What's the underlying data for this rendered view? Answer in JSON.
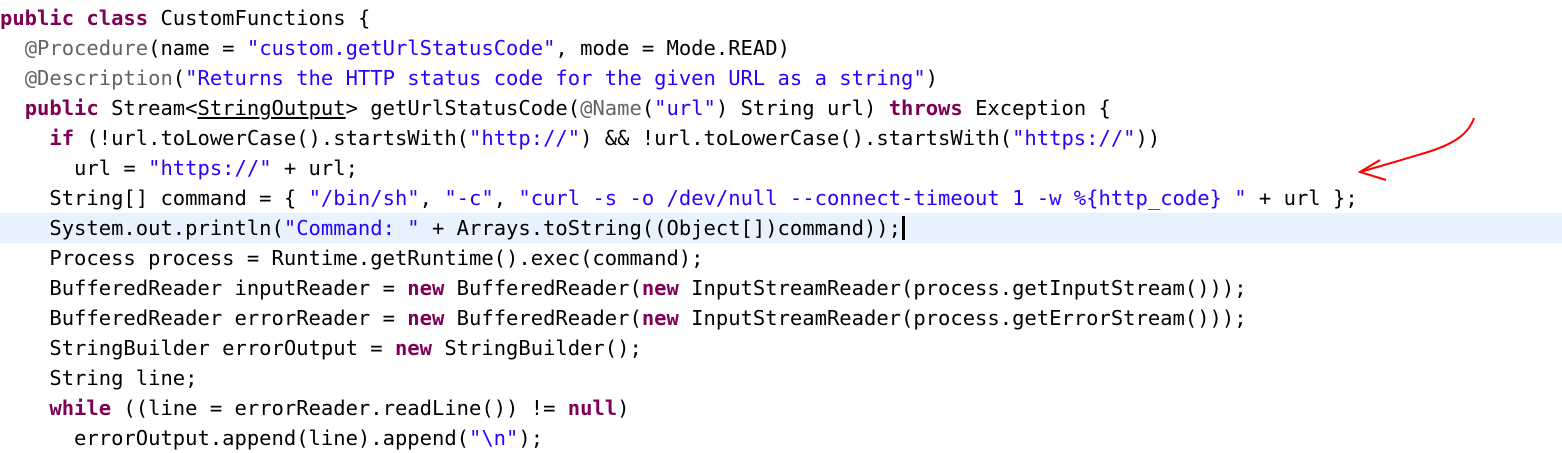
{
  "editor": {
    "language": "java",
    "current_line": 8,
    "colors": {
      "keyword": "#7f0055",
      "string": "#2a00ff",
      "annotation": "#646464",
      "text": "#000000",
      "current_line_bg": "#e8f2fe",
      "arrow": "#ff0000"
    },
    "lines": [
      [
        [
          "kw",
          "public"
        ],
        [
          "t",
          " "
        ],
        [
          "kw",
          "class"
        ],
        [
          "t",
          " CustomFunctions {"
        ]
      ],
      [
        [
          "t",
          "  "
        ],
        [
          "ann",
          "@Procedure"
        ],
        [
          "t",
          "(name = "
        ],
        [
          "str",
          "\"custom.getUrlStatusCode\""
        ],
        [
          "t",
          ", mode = Mode.READ)"
        ]
      ],
      [
        [
          "t",
          "  "
        ],
        [
          "ann",
          "@Description"
        ],
        [
          "t",
          "("
        ],
        [
          "str",
          "\"Returns the HTTP status code for the given URL as a string\""
        ],
        [
          "t",
          ")"
        ]
      ],
      [
        [
          "t",
          "  "
        ],
        [
          "kw",
          "public"
        ],
        [
          "t",
          " Stream<"
        ],
        [
          "ul",
          "StringOutput"
        ],
        [
          "t",
          "> getUrlStatusCode("
        ],
        [
          "ann",
          "@Name"
        ],
        [
          "t",
          "("
        ],
        [
          "str",
          "\"url\""
        ],
        [
          "t",
          ") String url) "
        ],
        [
          "kw",
          "throws"
        ],
        [
          "t",
          " Exception {"
        ]
      ],
      [
        [
          "t",
          "    "
        ],
        [
          "kw",
          "if"
        ],
        [
          "t",
          " (!url.toLowerCase().startsWith("
        ],
        [
          "str",
          "\"http://\""
        ],
        [
          "t",
          ") && !url.toLowerCase().startsWith("
        ],
        [
          "str",
          "\"https://\""
        ],
        [
          "t",
          "))"
        ]
      ],
      [
        [
          "t",
          "      url = "
        ],
        [
          "str",
          "\"https://\""
        ],
        [
          "t",
          " + url;"
        ]
      ],
      [
        [
          "t",
          "    String[] command = { "
        ],
        [
          "str",
          "\"/bin/sh\""
        ],
        [
          "t",
          ", "
        ],
        [
          "str",
          "\"-c\""
        ],
        [
          "t",
          ", "
        ],
        [
          "str",
          "\"curl -s -o /dev/null --connect-timeout 1 -w %{http_code} \""
        ],
        [
          "t",
          " + url };"
        ]
      ],
      [
        [
          "t",
          "    System.out.println("
        ],
        [
          "str",
          "\"Command: \""
        ],
        [
          "t",
          " + Arrays.toString((Object[])command));"
        ]
      ],
      [
        [
          "t",
          "    Process process = Runtime.getRuntime().exec(command);"
        ]
      ],
      [
        [
          "t",
          "    BufferedReader inputReader = "
        ],
        [
          "kw",
          "new"
        ],
        [
          "t",
          " BufferedReader("
        ],
        [
          "kw",
          "new"
        ],
        [
          "t",
          " InputStreamReader(process.getInputStream()));"
        ]
      ],
      [
        [
          "t",
          "    BufferedReader errorReader = "
        ],
        [
          "kw",
          "new"
        ],
        [
          "t",
          " BufferedReader("
        ],
        [
          "kw",
          "new"
        ],
        [
          "t",
          " InputStreamReader(process.getErrorStream()));"
        ]
      ],
      [
        [
          "t",
          "    StringBuilder errorOutput = "
        ],
        [
          "kw",
          "new"
        ],
        [
          "t",
          " StringBuilder();"
        ]
      ],
      [
        [
          "t",
          "    String line;"
        ]
      ],
      [
        [
          "t",
          "    "
        ],
        [
          "kw",
          "while"
        ],
        [
          "t",
          " ((line = errorReader.readLine()) != "
        ],
        [
          "kw",
          "null"
        ],
        [
          "t",
          ")"
        ]
      ],
      [
        [
          "t",
          "      errorOutput.append(line).append("
        ],
        [
          "str",
          "\"\\n\""
        ],
        [
          "t",
          ");"
        ]
      ]
    ]
  }
}
